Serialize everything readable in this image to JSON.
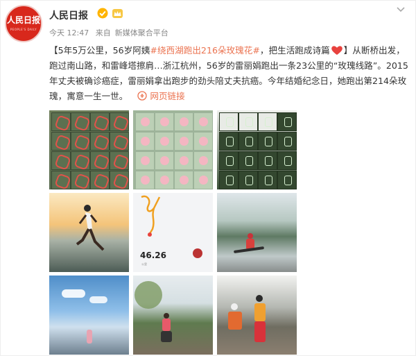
{
  "post": {
    "author": "人民日报",
    "avatar_text": "人民日报",
    "avatar_sub": "PEOPLE'S DAILY",
    "time": "今天 12:47",
    "source_prefix": "来自",
    "source": "新媒体聚合平台",
    "text_part1": "【5年5万公里，56岁阿姨",
    "hashtag": "#绕西湖跑出216朵玫瑰花#",
    "text_part2": "，把生活跑成诗篇",
    "text_part3": "】从断桥出发，跑过南山路，和雷峰塔擦肩…浙江杭州，56岁的雷丽娟跑出一条23公里的“玫瑰线路”。2015年丈夫被确诊癌症，雷丽娟拿出跑步的劲头陪丈夫抗癌。今年结婚纪念日，她跑出第214朵玫瑰，寓意一生一世。",
    "link_label": "网页链接"
  },
  "photos": {
    "stats_value": "46.26",
    "stats_unit": "公里"
  },
  "colors": {
    "accent": "#eb7350",
    "text": "#333333",
    "meta": "#888888",
    "brand": "#d8281c"
  }
}
